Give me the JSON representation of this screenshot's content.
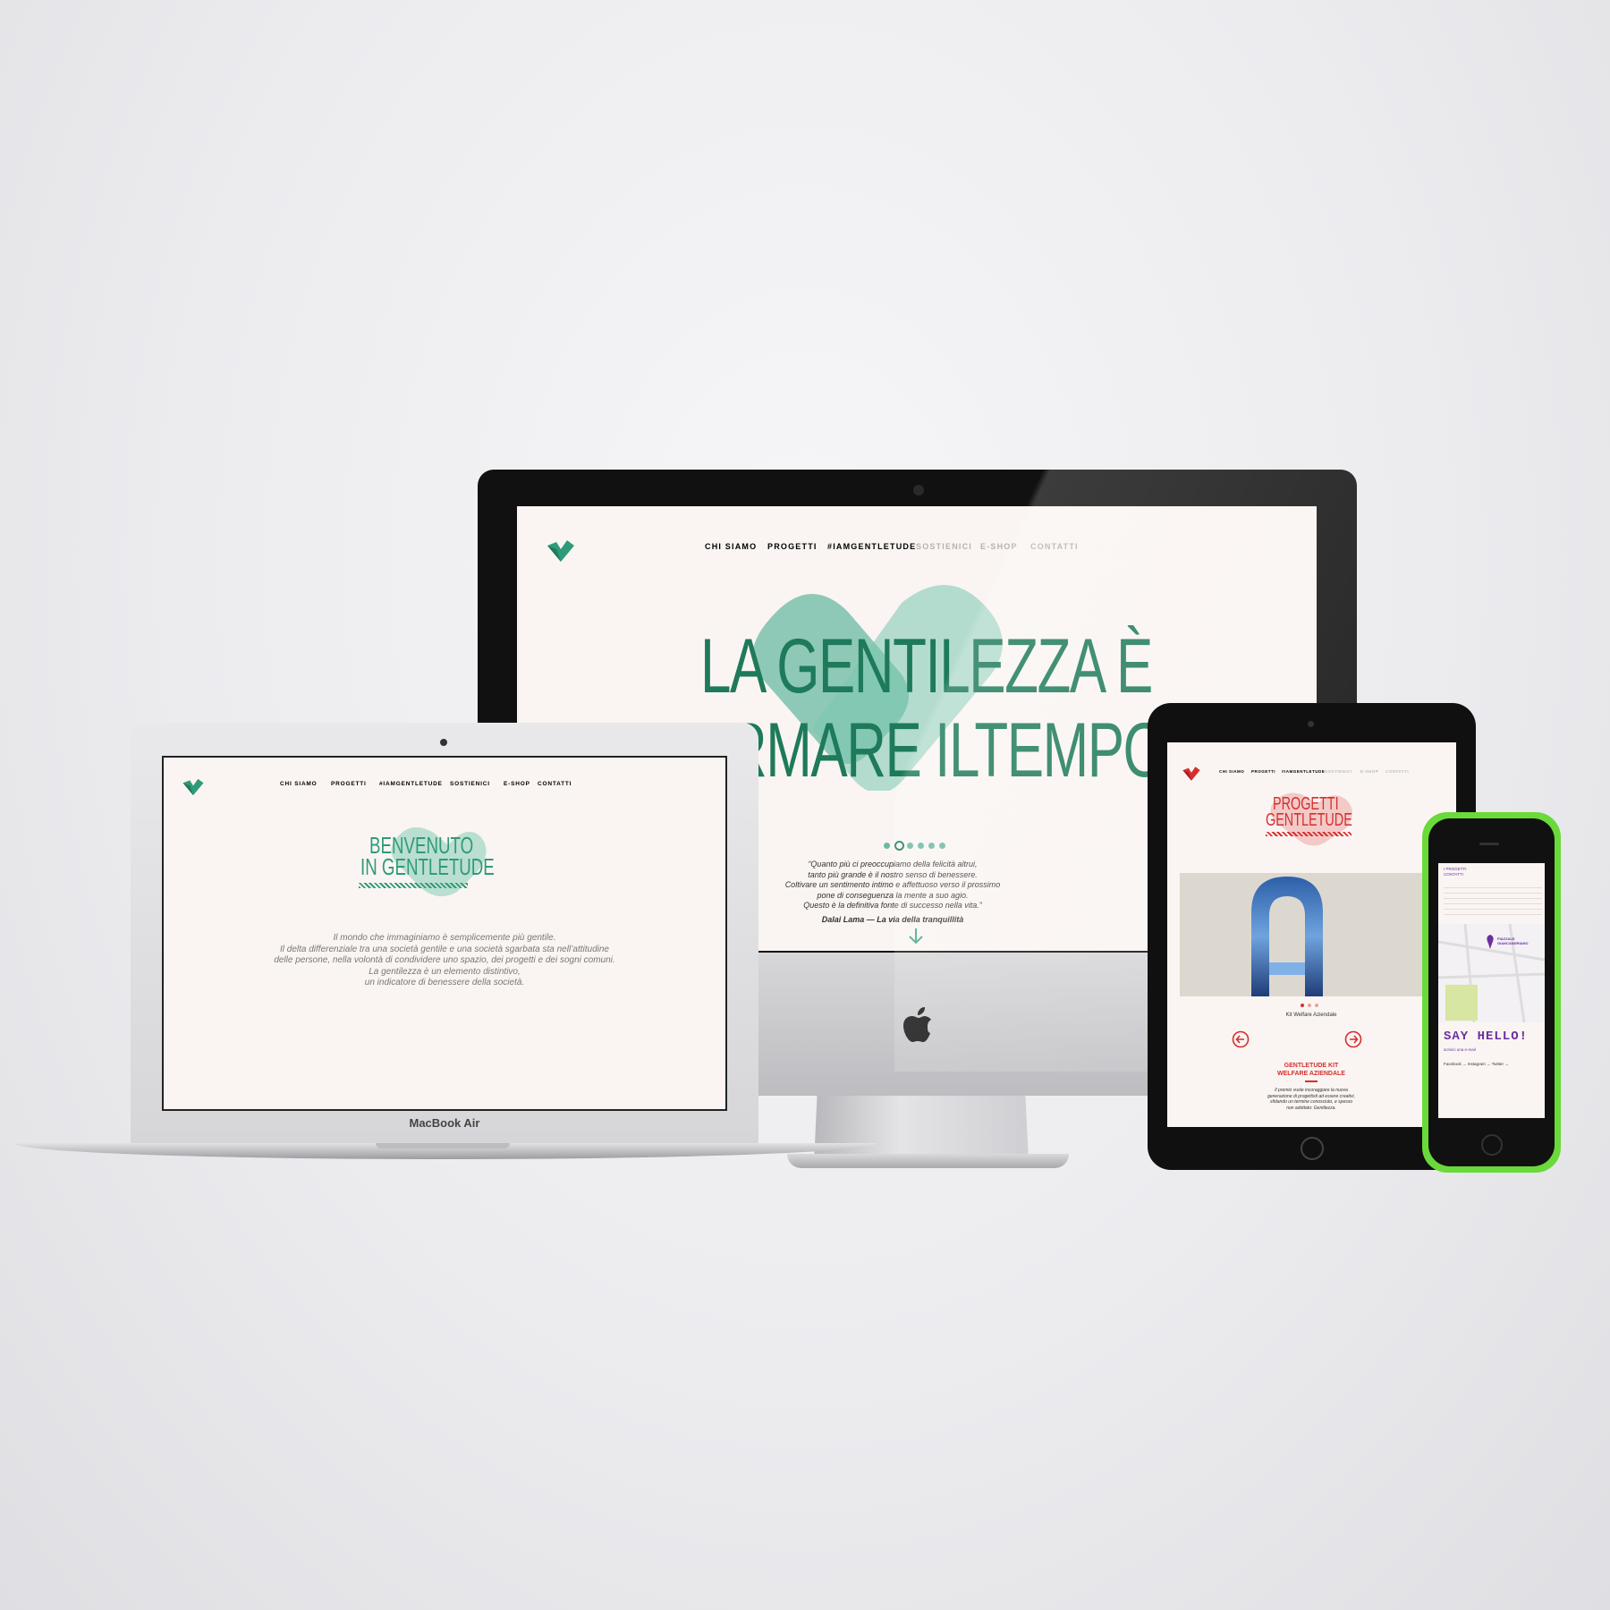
{
  "imac": {
    "nav": [
      "CHI SIAMO",
      "PROGETTI",
      "#IAMGENTLETUDE",
      "SOSTIENICI",
      "E-SHOP",
      "CONTATTI"
    ],
    "headline_line1": "LA GENTILEZZA È",
    "headline_line2": "RMARE ILTEMPO",
    "quote_lines": [
      "“Quanto più ci preoccupiamo della felicità altrui,",
      "tanto più grande è il nostro senso di benessere.",
      "Coltivare un sentimento intimo e affettuoso verso il prossimo",
      "pone di conseguenza la mente a suo agio.",
      "Questo è la definitiva fonte di successo nella vita.”"
    ],
    "quote_author": "Dalai Lama — La via della tranquillità",
    "slider_dots": 6,
    "colors": {
      "accent": "#1e7a5a",
      "blob": "#6ab9a3",
      "bg": "#faf5f2"
    }
  },
  "macbook": {
    "label": "MacBook Air",
    "nav": [
      "CHI SIAMO",
      "PROGETTI",
      "#IAMGENTLETUDE",
      "SOSTIENICI",
      "E-SHOP",
      "CONTATTI"
    ],
    "welcome_line1": "BENVENUTO",
    "welcome_line2": "IN GENTLETUDE",
    "body_lines": [
      "Il mondo che immaginiamo è semplicemente più gentile.",
      "Il delta differenziale tra una società gentile e una società sgarbata sta nell’attitudine",
      "delle persone, nella volontà di condividere uno spazio, dei progetti e dei sogni comuni.",
      "La gentilezza è un elemento distintivo,",
      "un indicatore di benessere della società."
    ]
  },
  "ipad": {
    "nav": [
      "CHI SIAMO",
      "PROGETTI",
      "#IAMGENTLETUDE",
      "SOSTIENICI",
      "E-SHOP",
      "CONTATTI"
    ],
    "title_line1": "PROGETTI",
    "title_line2": "GENTLETUDE",
    "slide_caption": "Kit Welfare Aziendale",
    "project_title_line1": "GENTLETUDE KIT",
    "project_title_line2": "WELFARE AZIENDALE",
    "description_lines": [
      "Il premio vuole incoraggiare la nuova",
      "generazione di progettisti ad essere creativi,",
      "sfidando un termine conosciuto, e spesso",
      "non adottato: Gentilezza."
    ],
    "colors": {
      "accent": "#d42f2f"
    }
  },
  "iphone": {
    "menu": [
      "I PROGETTI",
      "CONTATTI"
    ],
    "map_label_line1": "PIAZZALE",
    "map_label_line2": "GIANCANDRIANO",
    "say_hello": "SAY HELLO!",
    "email_line": "scrivici una e-mail",
    "social_line": "Facebook → Instagram → Twitter →",
    "colors": {
      "accent": "#6b2fa0",
      "body": "#6ad93a"
    }
  }
}
